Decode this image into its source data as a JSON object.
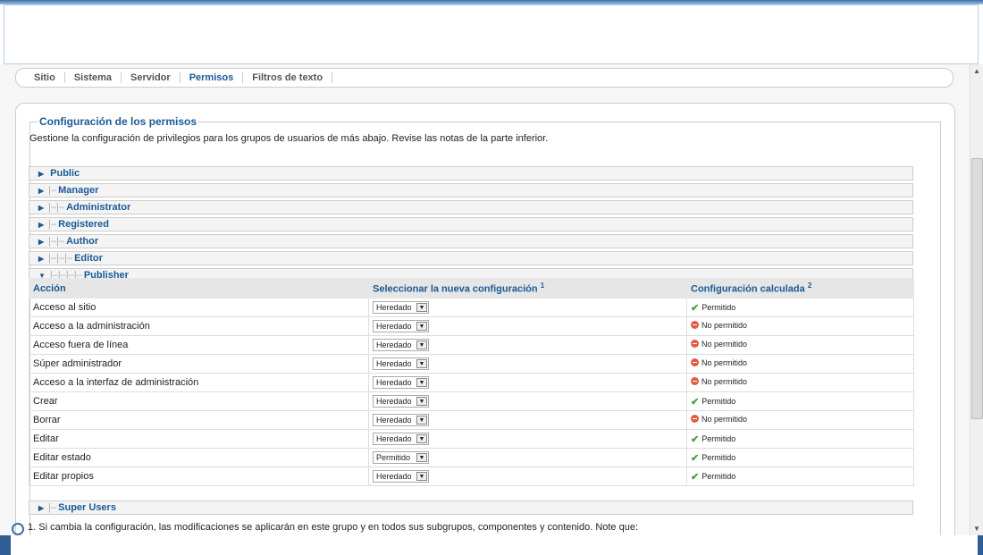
{
  "tabs": [
    "Sitio",
    "Sistema",
    "Servidor",
    "Permisos",
    "Filtros de texto"
  ],
  "active_tab": "Permisos",
  "section": {
    "legend": "Configuración de los permisos",
    "description": "Gestione la configuración de privilegios para los grupos de usuarios de más abajo. Revise las notas de la parte inferior."
  },
  "groups": [
    {
      "prefix": "",
      "name": "Public",
      "expanded": false
    },
    {
      "prefix": "|–",
      "name": "Manager",
      "expanded": false
    },
    {
      "prefix": "|–|–",
      "name": "Administrator",
      "expanded": false
    },
    {
      "prefix": "|–",
      "name": "Registered",
      "expanded": false
    },
    {
      "prefix": "|–|–",
      "name": "Author",
      "expanded": false
    },
    {
      "prefix": "|–|–|–",
      "name": "Editor",
      "expanded": false
    },
    {
      "prefix": "|–|–|–|–",
      "name": "Publisher",
      "expanded": true
    },
    {
      "prefix": "|–",
      "name": "Super Users",
      "expanded": false
    }
  ],
  "table": {
    "headers": {
      "action": "Acción",
      "new_setting": "Seleccionar la nueva configuración",
      "new_setting_sup": "1",
      "calculated": "Configuración calculada",
      "calculated_sup": "2"
    },
    "rows": [
      {
        "action": "Acceso al sitio",
        "setting": "Heredado",
        "calc": "Permitido",
        "allowed": true
      },
      {
        "action": "Acceso a la administración",
        "setting": "Heredado",
        "calc": "No permitido",
        "allowed": false
      },
      {
        "action": "Acceso fuera de línea",
        "setting": "Heredado",
        "calc": "No permitido",
        "allowed": false
      },
      {
        "action": "Súper administrador",
        "setting": "Heredado",
        "calc": "No permitido",
        "allowed": false
      },
      {
        "action": "Acceso a la interfaz de administración",
        "setting": "Heredado",
        "calc": "No permitido",
        "allowed": false
      },
      {
        "action": "Crear",
        "setting": "Heredado",
        "calc": "Permitido",
        "allowed": true
      },
      {
        "action": "Borrar",
        "setting": "Heredado",
        "calc": "No permitido",
        "allowed": false
      },
      {
        "action": "Editar",
        "setting": "Heredado",
        "calc": "Permitido",
        "allowed": true
      },
      {
        "action": "Editar estado",
        "setting": "Permitido",
        "calc": "Permitido",
        "allowed": true
      },
      {
        "action": "Editar propios",
        "setting": "Heredado",
        "calc": "Permitido",
        "allowed": true
      }
    ]
  },
  "footnote": "1. Si cambia la configuración, las modificaciones se aplicarán en este grupo y en todos sus subgrupos, componentes y contenido. Note que:"
}
